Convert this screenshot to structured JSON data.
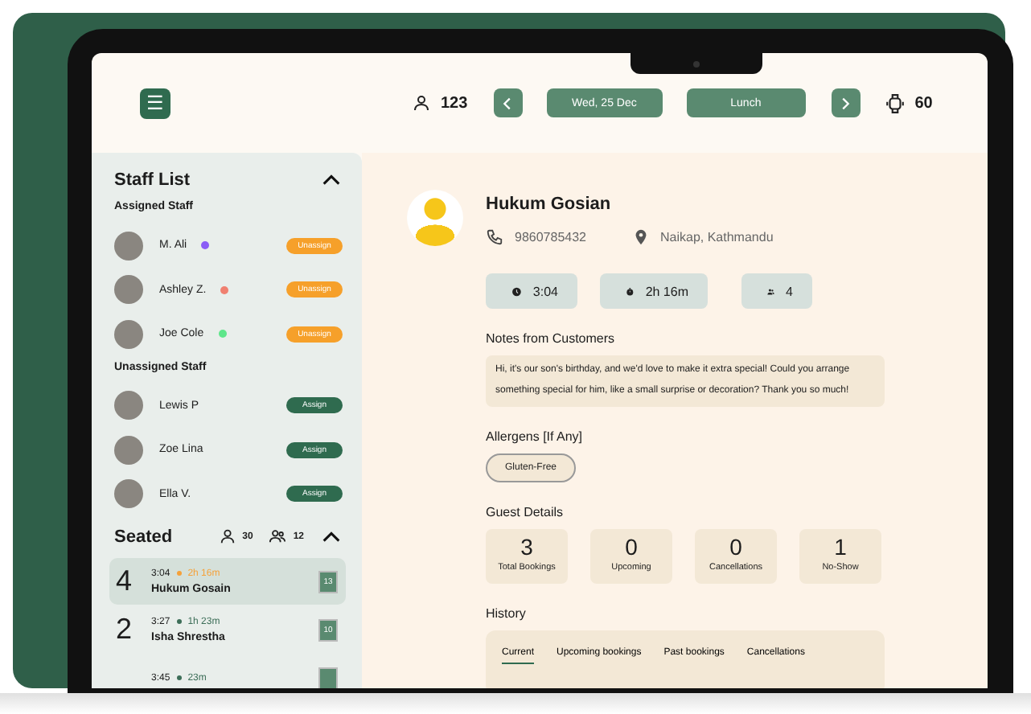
{
  "top_bar": {
    "menu_icon": "☰",
    "guest_count": "123",
    "date": "Wed, 25 Dec",
    "service": "Lunch",
    "table_count": "60"
  },
  "staff_list": {
    "title": "Staff List",
    "expanded": true,
    "groups": [
      {
        "title": "Assigned Staff",
        "kind": "assigned",
        "members": [
          {
            "name": "M. Ali",
            "color": "#8b5cf6",
            "action": "Unassign"
          },
          {
            "name": "Ashley Z.",
            "color": "#f08070",
            "action": "Unassign"
          },
          {
            "name": "Joe Cole",
            "color": "#5ee68a",
            "action": "Unassign"
          }
        ]
      },
      {
        "title": "Unassigned Staff",
        "kind": "unassigned",
        "members": [
          {
            "name": "Lewis P",
            "action": "Assign"
          },
          {
            "name": "Zoe Lina",
            "action": "Assign"
          },
          {
            "name": "Ella V.",
            "action": "Assign"
          }
        ]
      }
    ]
  },
  "seated": {
    "title": "Seated",
    "guests": "30",
    "parties": "12",
    "expanded": true,
    "rows": [
      {
        "party": "4",
        "time": "3:04",
        "duration": "2h 16m",
        "color": "#f5a13a",
        "name": "Hukum Gosain",
        "table": "13",
        "selected": true
      },
      {
        "party": "2",
        "time": "3:27",
        "duration": "1h 23m",
        "color": "#3d6e58",
        "name": "Isha Shrestha",
        "table": "10",
        "selected": false
      },
      {
        "time": "3:45",
        "duration": "23m",
        "color": "#3d6e58",
        "selected": false
      }
    ]
  },
  "guest": {
    "name": "Hukum Gosian",
    "phone": "9860785432",
    "address": "Naikap, Kathmandu",
    "chips": [
      {
        "kind": "clock",
        "text": "3:04"
      },
      {
        "kind": "timer",
        "text": "2h 16m"
      },
      {
        "kind": "people",
        "text": "4"
      }
    ],
    "notes_title": "Notes from Customers",
    "notes": "Hi, it's our son's birthday, and we'd love to make it extra special! Could you arrange something special for him, like a small surprise or decoration? Thank you so much!",
    "allergens_title": "Allergens [If Any]",
    "allergens": [
      "Gluten-Free"
    ],
    "details_title": "Guest Details",
    "stats": [
      {
        "value": "3",
        "label": "Total Bookings"
      },
      {
        "value": "0",
        "label": "Upcoming"
      },
      {
        "value": "0",
        "label": "Cancellations"
      },
      {
        "value": "1",
        "label": "No-Show"
      }
    ],
    "history_title": "History",
    "history_tabs": [
      {
        "label": "Current",
        "selected": true
      },
      {
        "label": "Upcoming bookings",
        "selected": false
      },
      {
        "label": "Past bookings",
        "selected": false
      },
      {
        "label": "Cancellations",
        "selected": false
      }
    ]
  }
}
